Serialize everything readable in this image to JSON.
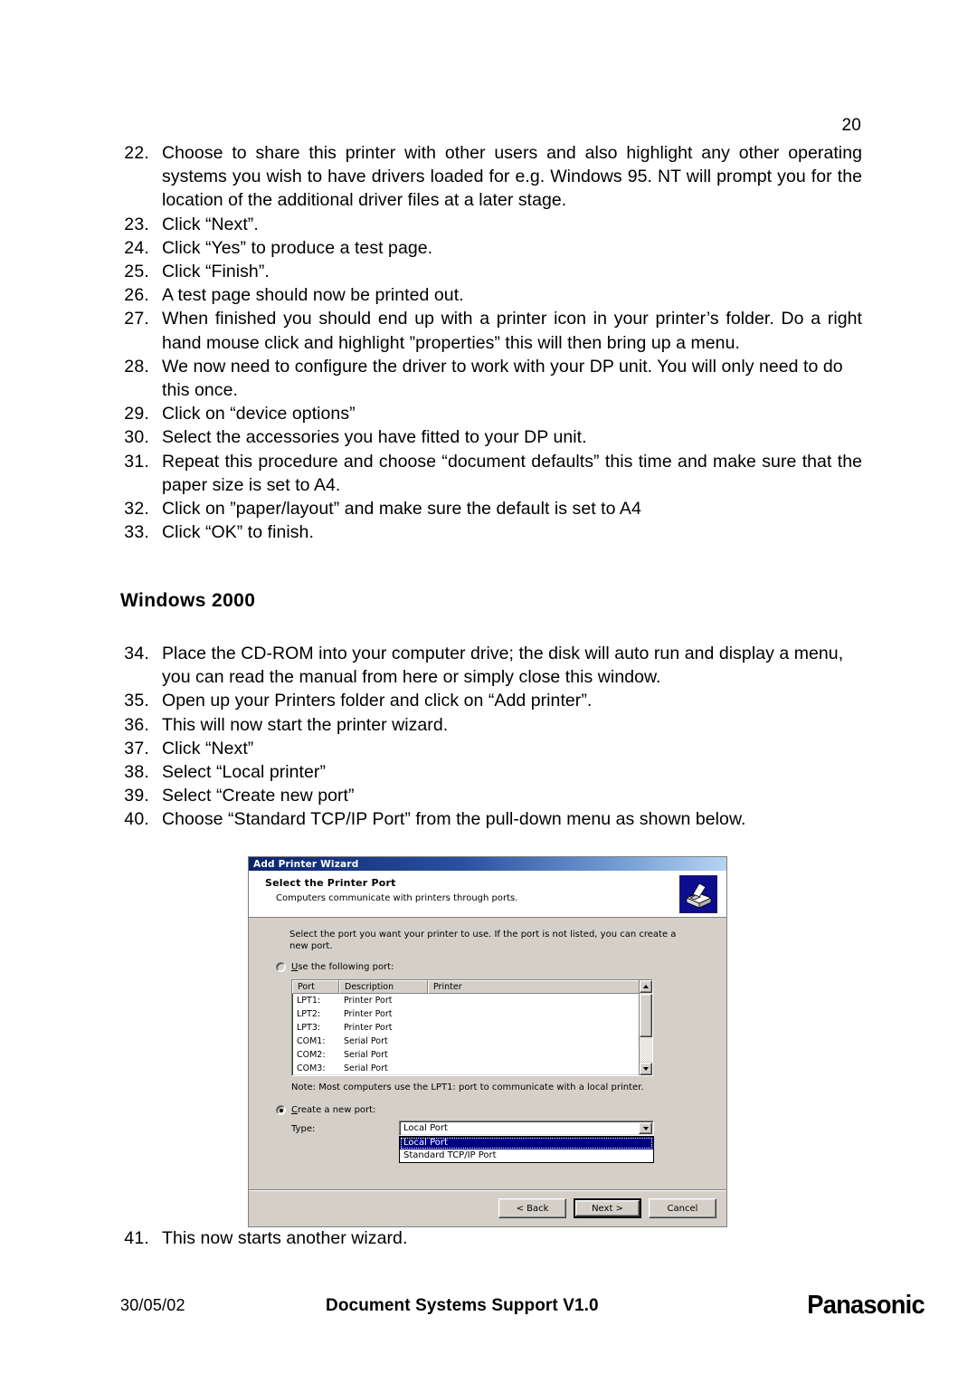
{
  "page": {
    "number": "20"
  },
  "steps_part1": [
    {
      "num": "22.",
      "text": "Choose to share this printer with other users and also highlight any other operating systems you wish to have drivers loaded for e.g. Windows 95. NT will prompt you for the location of the additional driver files at a later stage.",
      "justify": true
    },
    {
      "num": "23.",
      "text": "Click “Next”.",
      "justify": false
    },
    {
      "num": "24.",
      "text": "Click “Yes” to produce a test page.",
      "justify": false
    },
    {
      "num": "25.",
      "text": "Click “Finish”.",
      "justify": false
    },
    {
      "num": "26.",
      "text": "A test page should now be printed out.",
      "justify": false
    },
    {
      "num": "27.",
      "text": "When finished you should end up with a printer icon in your printer’s folder. Do a right hand mouse click and highlight ”properties” this will then bring up a menu.",
      "justify": true
    },
    {
      "num": "28.",
      "text": "We now need to configure the driver to work with your DP unit. You will only need to do this once.",
      "justify": false
    },
    {
      "num": "29.",
      "text": "Click on “device options”",
      "justify": false
    },
    {
      "num": "30.",
      "text": "Select the accessories you have fitted to your DP unit.",
      "justify": false
    },
    {
      "num": "31.",
      "text": "Repeat this procedure and choose “document defaults” this time and make sure that the paper size is set to A4.",
      "justify": true
    },
    {
      "num": "32.",
      "text": "Click on ”paper/layout” and make sure the default is set to A4",
      "justify": false
    },
    {
      "num": "33.",
      "text": "Click “OK” to finish.",
      "justify": false
    }
  ],
  "section_heading": "Windows 2000",
  "steps_part2": [
    {
      "num": "34.",
      "text": "Place the CD-ROM into your computer drive; the disk will auto run and display a menu, you can read the manual from here or simply close this window.",
      "justify": false
    },
    {
      "num": "35.",
      "text": "Open up your Printers folder and click on “Add printer”.",
      "justify": false
    },
    {
      "num": "36.",
      "text": "This will now start the printer wizard.",
      "justify": false
    },
    {
      "num": "37.",
      "text": "Click “Next”",
      "justify": false
    },
    {
      "num": "38.",
      "text": "Select “Local printer”",
      "justify": false
    },
    {
      "num": "39.",
      "text": "Select “Create new port”",
      "justify": false
    },
    {
      "num": "40.",
      "text": "Choose “Standard TCP/IP Port” from the pull-down menu as shown below.",
      "justify": false
    }
  ],
  "steps_part3": [
    {
      "num": "41.",
      "text": "This now starts another wizard.",
      "justify": false
    }
  ],
  "dialog": {
    "titlebar": "Add Printer Wizard",
    "header_title": "Select the Printer Port",
    "header_subtitle": "Computers communicate with printers through ports.",
    "intro": "Select the port you want your printer to use.  If the port is not listed, you can create a new port.",
    "radio_use_existing": {
      "label_pre": "U",
      "label_post": "se the following port:",
      "checked": false
    },
    "radio_create_new": {
      "label_pre": "C",
      "label_post": "reate a new port:",
      "checked": true
    },
    "columns": [
      "Port",
      "Description",
      "Printer"
    ],
    "rows": [
      {
        "port": "LPT1:",
        "description": "Printer Port",
        "printer": ""
      },
      {
        "port": "LPT2:",
        "description": "Printer Port",
        "printer": ""
      },
      {
        "port": "LPT3:",
        "description": "Printer Port",
        "printer": ""
      },
      {
        "port": "COM1:",
        "description": "Serial Port",
        "printer": ""
      },
      {
        "port": "COM2:",
        "description": "Serial Port",
        "printer": ""
      },
      {
        "port": "COM3:",
        "description": "Serial Port",
        "printer": ""
      }
    ],
    "note": "Note: Most computers use the LPT1: port to communicate with a local printer.",
    "type_label": "Type:",
    "combo_value": "Local Port",
    "combo_options": [
      "Local Port",
      "Standard TCP/IP Port"
    ],
    "combo_selected_index": 0,
    "buttons": {
      "back": "< Back",
      "next": "Next >",
      "cancel": "Cancel"
    },
    "colors": {
      "titlebar_dark": "#0a246a",
      "titlebar_light": "#b6d4f2",
      "face": "#d4d0c8",
      "highlight": "#000080",
      "icon_background": "#000080"
    }
  },
  "footer": {
    "date": "30/05/02",
    "center": "Document Systems Support V1.0",
    "logo": "Panasonic"
  }
}
